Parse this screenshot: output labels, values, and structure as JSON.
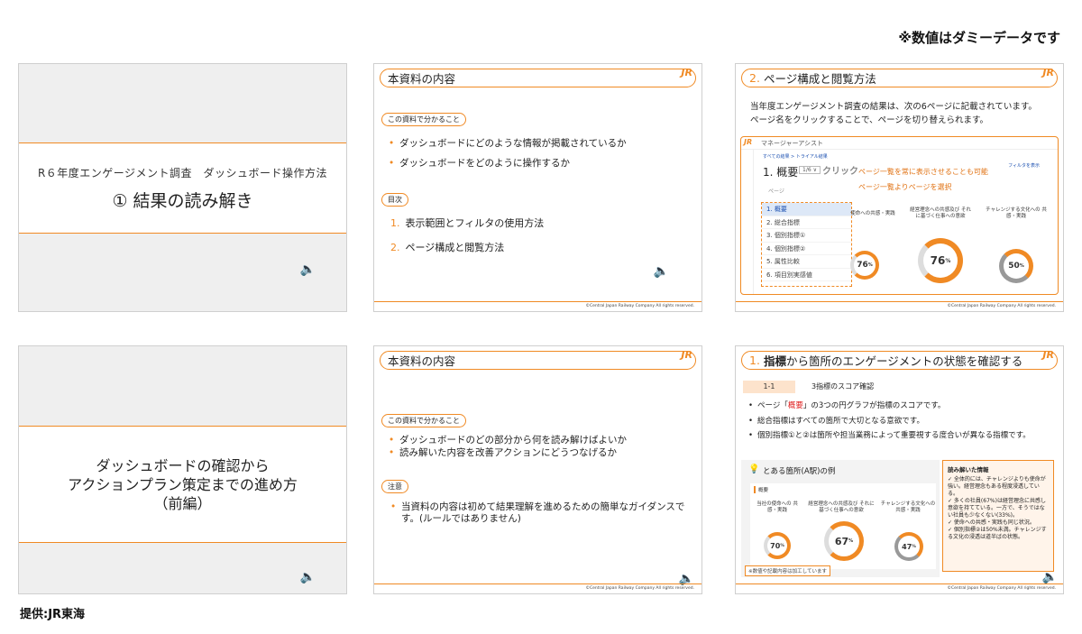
{
  "top_note": "※数値はダミーデータです",
  "credit": "提供:JR東海",
  "logo": "JR",
  "footer": "©Central Japan Railway Company All rights reserved.",
  "speaker_icon": "🔈",
  "slide1": {
    "subtitle": "R６年度エンゲージメント調査　ダッシュボード操作方法",
    "title": "① 結果の読み解き"
  },
  "slide2": {
    "header": "本資料の内容",
    "pill_understand": "この資料で分かること",
    "bullets": [
      "ダッシュボードにどのような情報が掲載されているか",
      "ダッシュボードをどのように操作するか"
    ],
    "pill_toc": "目次",
    "toc": [
      {
        "num": "1.",
        "label": "表示範囲とフィルタの使用方法"
      },
      {
        "num": "2.",
        "label": "ページ構成と閲覧方法"
      }
    ]
  },
  "slide3": {
    "header_num": "2.",
    "header": "ページ構成と閲覧方法",
    "line1": "当年度エンゲージメント調査の結果は、次の6ページに記載されています。",
    "line2": "ページ名をクリックすることで、ページを切り替えられます。",
    "app_title": "マネージャーアシスト",
    "breadcrumb": "すべての結果 > トライアル結果",
    "page_title": "1. 概要",
    "page_count": "1/6 ∨",
    "click": "クリック",
    "ann1": "ページ一覧を常に表示させることも可能",
    "ann2": "ページ一覧よりページを選択",
    "dd_label": "ページ",
    "pages": [
      "1. 概要",
      "2. 総合指標",
      "3. 個別指標①",
      "4. 個別指標②",
      "5. 属性比較",
      "6. 項目別実感値"
    ],
    "filter_label": "フィルタを表示",
    "col1": "使命への共感・実践",
    "col2": "経営理念への共感及び それに基づく仕事への意欲",
    "col3": "チャレンジする文化への 共感・実践",
    "v1": "76",
    "v2": "76",
    "v3": "50",
    "pct": "%"
  },
  "slide4": {
    "lines": [
      "ダッシュボードの確認から",
      "アクションプラン策定までの進め方",
      "（前編）"
    ]
  },
  "slide5": {
    "header": "本資料の内容",
    "pill_understand": "この資料で分かること",
    "bullets": [
      "ダッシュボードのどの部分から何を読み解けばよいか",
      "読み解いた内容を改善アクションにどうつなげるか"
    ],
    "pill_note": "注意",
    "note": "当資料の内容は初めて結果理解を進めるための簡単なガイダンスです。(ルールではありません)"
  },
  "slide6": {
    "header_num": "1.",
    "header_bold": "指標",
    "header_rest": "から箇所のエンゲージメントの状態を確認する",
    "sec_num": "1-1",
    "sec_title": "3指標のスコア確認",
    "b1_pre": "ページ「",
    "b1_hl": "概要",
    "b1_post": "」の3つの円グラフが指標のスコアです。",
    "b2": "総合指標はすべての箇所で大切となる意欲です。",
    "b3": "個別指標①と②は箇所や担当業務によって重要視する度合いが異なる指標です。",
    "example_title": "とある箇所(A駅)の例",
    "overview_label": "概要",
    "col1": "当社の使命への 共感・実践",
    "col2": "経営理念への共感及び それに基づく仕事への意欲",
    "col3": "チャレンジする文化への 共感・実践",
    "v1": "70",
    "v2": "67",
    "v3": "47",
    "pct": "%",
    "disclaimer": "※数値や記載内容は加工しています",
    "read_title": "読み解いた情報",
    "read_items": [
      "✓ 全体的には、チャレンジよりも使命が強い。経営理念もある程度浸透している。",
      "✓ 多くの社員(67%)は経営理念に共感し意欲を持てている。一方で、そうではない社員も少なくない(33%)。",
      "✓ 使命への共感・実践も同じ状況。",
      "✓ 個別指標②は50%未満。チャレンジする文化の浸透は道半ばの状態。"
    ]
  }
}
